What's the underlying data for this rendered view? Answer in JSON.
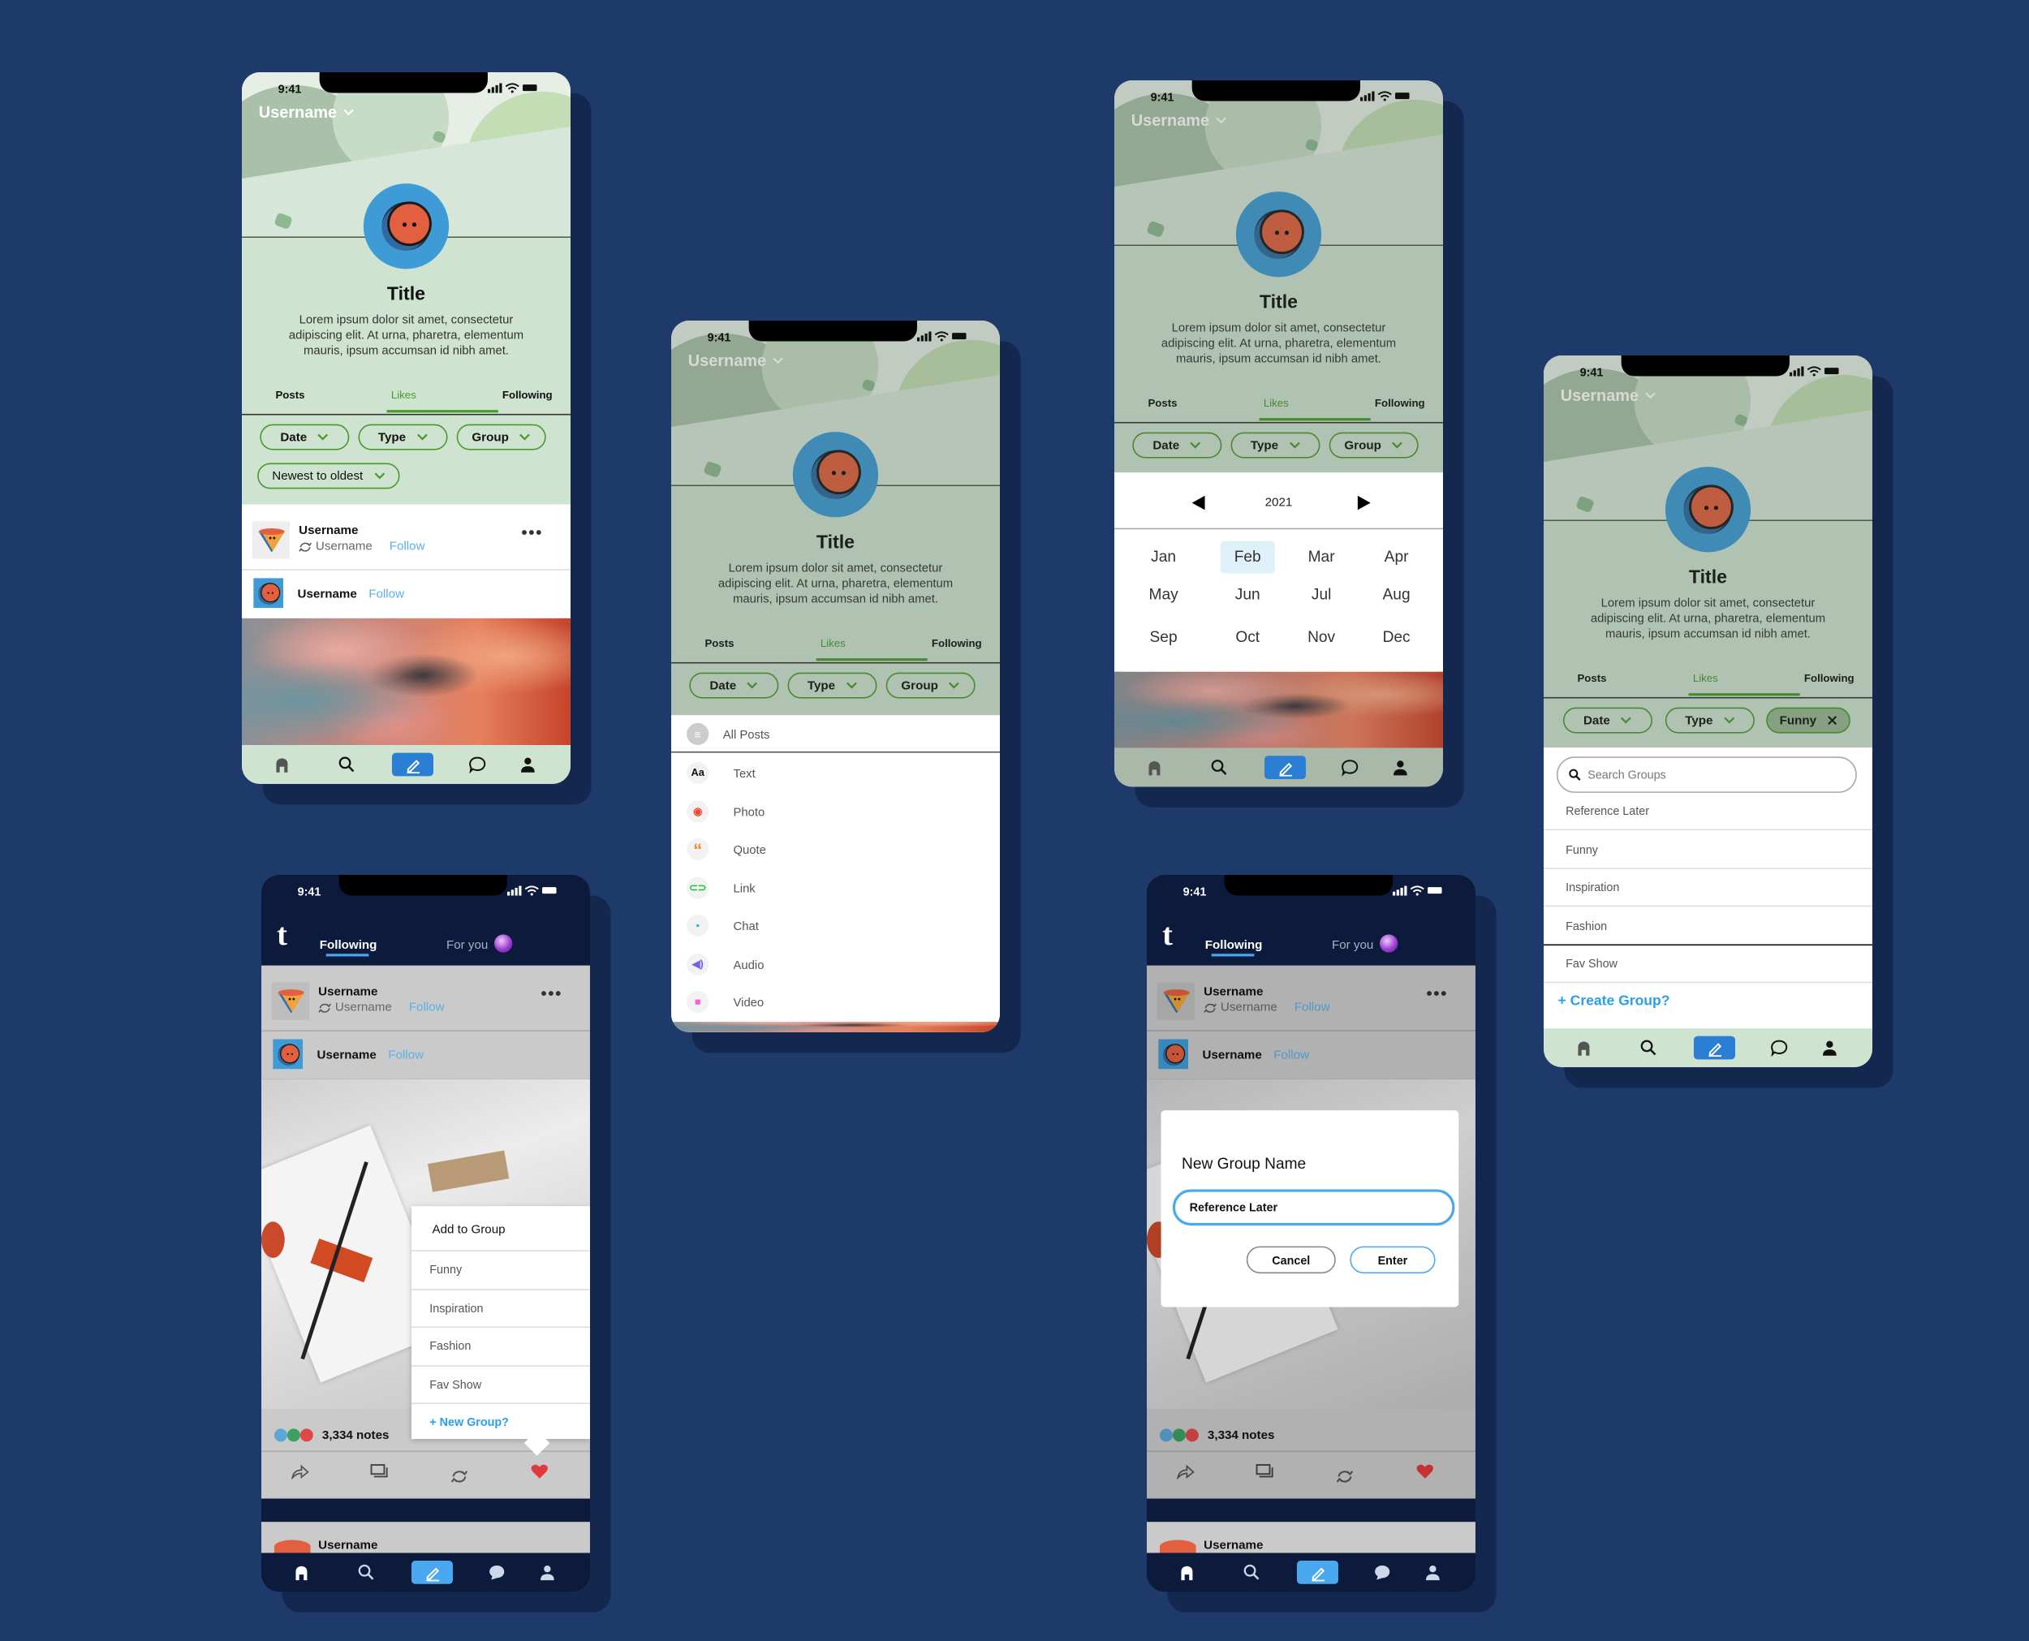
{
  "status": {
    "time": "9:41"
  },
  "profile": {
    "username": "Username",
    "title": "Title",
    "bio": "Lorem ipsum dolor sit amet, consectetur adipiscing elit. At urna, pharetra, elementum mauris, ipsum accumsan id nibh amet.",
    "tabs": [
      "Posts",
      "Likes",
      "Following"
    ],
    "active_tab": "Likes"
  },
  "filters": {
    "date": "Date",
    "type": "Type",
    "group": "Group",
    "sort": "Newest to oldest",
    "group_selected": "Funny"
  },
  "post": {
    "reblogger": "Username",
    "source": "Username",
    "author": "Username",
    "follow": "Follow",
    "notes": "3,334 notes",
    "next_author": "Username"
  },
  "feed_header": {
    "following": "Following",
    "for_you": "For you"
  },
  "type_menu": {
    "all": "All Posts",
    "items": [
      {
        "label": "Text",
        "icon": "text-icon",
        "color": "#111111"
      },
      {
        "label": "Photo",
        "icon": "camera-icon",
        "color": "#f0492f"
      },
      {
        "label": "Quote",
        "icon": "quote-icon",
        "color": "#f28a1e"
      },
      {
        "label": "Link",
        "icon": "link-icon",
        "color": "#22c13a"
      },
      {
        "label": "Chat",
        "icon": "chat-icon",
        "color": "#2bb5f5"
      },
      {
        "label": "Audio",
        "icon": "audio-icon",
        "color": "#7b5cf0"
      },
      {
        "label": "Video",
        "icon": "video-icon",
        "color": "#ff5ad8"
      }
    ]
  },
  "calendar": {
    "year": "2021",
    "months": [
      "Jan",
      "Feb",
      "Mar",
      "Apr",
      "May",
      "Jun",
      "Jul",
      "Aug",
      "Sep",
      "Oct",
      "Nov",
      "Dec"
    ],
    "selected": "Feb"
  },
  "group_dropdown": {
    "search_placeholder": "Search Groups",
    "items": [
      "Reference Later",
      "Funny",
      "Inspiration",
      "Fashion",
      "Fav Show"
    ],
    "create": "+ Create Group?"
  },
  "add_to_group": {
    "title": "Add to Group",
    "items": [
      "Funny",
      "Inspiration",
      "Fashion",
      "Fav Show"
    ],
    "new_group": "+ New Group?"
  },
  "new_group_modal": {
    "title": "New Group Name",
    "value": "Reference Later",
    "cancel": "Cancel",
    "enter": "Enter"
  },
  "colors": {
    "background": "#1d3a6b",
    "accent_green": "#4a9a2a",
    "link_blue": "#5ab0e8",
    "compose_blue": "#2a7fd4",
    "feed_navy": "#0c1a3b",
    "heart_red": "#e03a3a"
  }
}
